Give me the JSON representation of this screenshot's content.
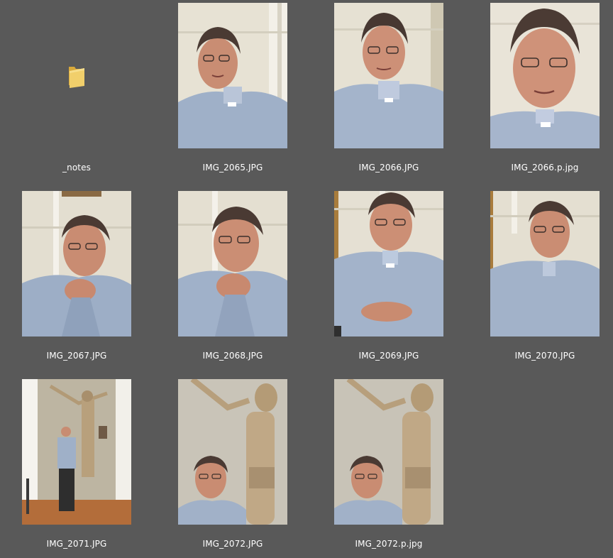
{
  "items": [
    {
      "name": "_notes",
      "kind": "folder"
    },
    {
      "name": "IMG_2065.JPG",
      "kind": "photo",
      "scene": "portrait"
    },
    {
      "name": "IMG_2066.JPG",
      "kind": "photo",
      "scene": "portrait"
    },
    {
      "name": "IMG_2066.p.jpg",
      "kind": "photo",
      "scene": "portrait-close"
    },
    {
      "name": "IMG_2067.JPG",
      "kind": "photo",
      "scene": "portrait-hand"
    },
    {
      "name": "IMG_2068.JPG",
      "kind": "photo",
      "scene": "portrait-hand"
    },
    {
      "name": "IMG_2069.JPG",
      "kind": "photo",
      "scene": "portrait-hands-folded"
    },
    {
      "name": "IMG_2070.JPG",
      "kind": "photo",
      "scene": "portrait"
    },
    {
      "name": "IMG_2071.JPG",
      "kind": "photo",
      "scene": "standing-crucifix"
    },
    {
      "name": "IMG_2072.JPG",
      "kind": "photo",
      "scene": "crucifix-portrait"
    },
    {
      "name": "IMG_2072.p.jpg",
      "kind": "photo",
      "scene": "crucifix-portrait"
    }
  ],
  "colors": {
    "background": "#595959",
    "label": "#ffffff",
    "folder": "#e8c25a"
  }
}
